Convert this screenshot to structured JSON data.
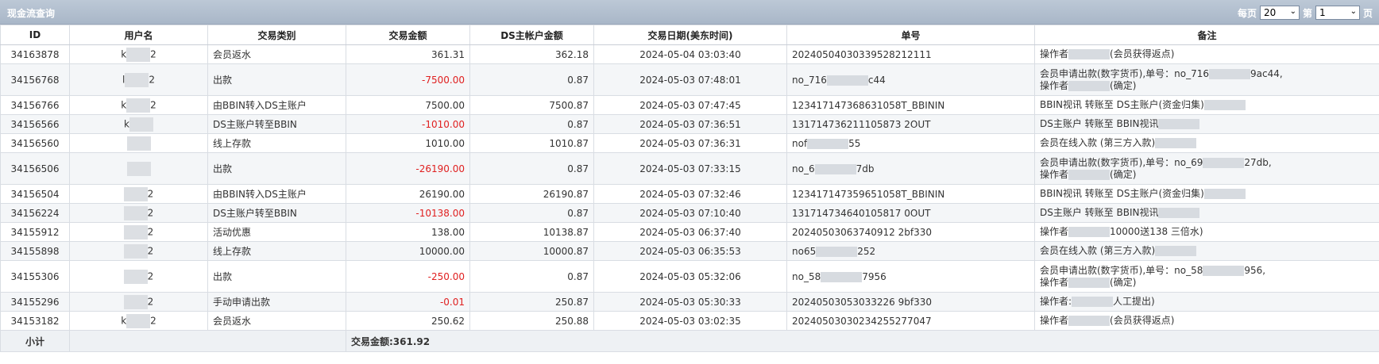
{
  "panel": {
    "title": "现金流查询",
    "per_page_label": "每页",
    "per_page_value": "20",
    "page_label": "第",
    "page_value": "1",
    "page_suffix": "页"
  },
  "table": {
    "headers": [
      "ID",
      "用户名",
      "交易类别",
      "交易金额",
      "DS主帐户金额",
      "交易日期(美东时间)",
      "单号",
      "备注"
    ],
    "rows": [
      {
        "id": "34163878",
        "user_a": "k",
        "user_b": "2",
        "type": "会员返水",
        "amount": "361.31",
        "neg": false,
        "balance": "362.18",
        "date": "2024-05-04 03:03:40",
        "order_a": "20240504030339528212111",
        "order_b": "",
        "note1_a": "操作者",
        "note1_b": "(会员获得返点)",
        "note2_a": "",
        "note2_b": ""
      },
      {
        "id": "34156768",
        "user_a": "l",
        "user_b": "2",
        "type": "出款",
        "amount": "-7500.00",
        "neg": true,
        "balance": "0.87",
        "date": "2024-05-03 07:48:01",
        "order_a": "no_716",
        "order_b": "c44",
        "note1_a": "会员申请出款(数字货币),单号：no_716",
        "note1_b": "9ac44,",
        "note2_a": "操作者",
        "note2_b": "(确定)"
      },
      {
        "id": "34156766",
        "user_a": "k",
        "user_b": "2",
        "type": "由BBIN转入DS主账户",
        "amount": "7500.00",
        "neg": false,
        "balance": "7500.87",
        "date": "2024-05-03 07:47:45",
        "order_a": "123417147368631058T_BBININ",
        "order_b": "",
        "note1_a": "BBIN视讯 转账至 DS主账户(资金归集)",
        "note1_b": "",
        "note2_a": "",
        "note2_b": ""
      },
      {
        "id": "34156566",
        "user_a": "k",
        "user_b": "",
        "type": "DS主账户转至BBIN",
        "amount": "-1010.00",
        "neg": true,
        "balance": "0.87",
        "date": "2024-05-03 07:36:51",
        "order_a": "131714736211105873 2OUT",
        "order_b": "",
        "note1_a": "DS主账户 转账至 BBIN视讯",
        "note1_b": "",
        "note2_a": "",
        "note2_b": ""
      },
      {
        "id": "34156560",
        "user_a": "",
        "user_b": "",
        "type": "线上存款",
        "amount": "1010.00",
        "neg": false,
        "balance": "1010.87",
        "date": "2024-05-03 07:36:31",
        "order_a": "nof",
        "order_b": "55",
        "note1_a": "会员在线入款 (第三方入款)",
        "note1_b": "",
        "note2_a": "",
        "note2_b": ""
      },
      {
        "id": "34156506",
        "user_a": "",
        "user_b": "",
        "type": "出款",
        "amount": "-26190.00",
        "neg": true,
        "balance": "0.87",
        "date": "2024-05-03 07:33:15",
        "order_a": "no_6",
        "order_b": "7db",
        "note1_a": "会员申请出款(数字货币),单号：no_69",
        "note1_b": "27db,",
        "note2_a": "操作者",
        "note2_b": "(确定)"
      },
      {
        "id": "34156504",
        "user_a": "",
        "user_b": "2",
        "type": "由BBIN转入DS主账户",
        "amount": "26190.00",
        "neg": false,
        "balance": "26190.87",
        "date": "2024-05-03 07:32:46",
        "order_a": "123417147359651058T_BBININ",
        "order_b": "",
        "note1_a": "BBIN视讯 转账至 DS主账户(资金归集)",
        "note1_b": "",
        "note2_a": "",
        "note2_b": ""
      },
      {
        "id": "34156224",
        "user_a": "",
        "user_b": "2",
        "type": "DS主账户转至BBIN",
        "amount": "-10138.00",
        "neg": true,
        "balance": "0.87",
        "date": "2024-05-03 07:10:40",
        "order_a": "131714734640105817 0OUT",
        "order_b": "",
        "note1_a": "DS主账户 转账至 BBIN视讯",
        "note1_b": "",
        "note2_a": "",
        "note2_b": ""
      },
      {
        "id": "34155912",
        "user_a": "",
        "user_b": "2",
        "type": "活动优惠",
        "amount": "138.00",
        "neg": false,
        "balance": "10138.87",
        "date": "2024-05-03 06:37:40",
        "order_a": "20240503063740912 2bf330",
        "order_b": "",
        "note1_a": "操作者",
        "note1_b": "10000送138 三倍水)",
        "note2_a": "",
        "note2_b": ""
      },
      {
        "id": "34155898",
        "user_a": "",
        "user_b": "2",
        "type": "线上存款",
        "amount": "10000.00",
        "neg": false,
        "balance": "10000.87",
        "date": "2024-05-03 06:35:53",
        "order_a": "no65",
        "order_b": "252",
        "note1_a": "会员在线入款 (第三方入款)",
        "note1_b": "",
        "note2_a": "",
        "note2_b": ""
      },
      {
        "id": "34155306",
        "user_a": "",
        "user_b": "2",
        "type": "出款",
        "amount": "-250.00",
        "neg": true,
        "balance": "0.87",
        "date": "2024-05-03 05:32:06",
        "order_a": "no_58",
        "order_b": "7956",
        "note1_a": "会员申请出款(数字货币),单号：no_58",
        "note1_b": "956,",
        "note2_a": "操作者",
        "note2_b": "(确定)"
      },
      {
        "id": "34155296",
        "user_a": "",
        "user_b": "2",
        "type": "手动申请出款",
        "amount": "-0.01",
        "neg": true,
        "balance": "250.87",
        "date": "2024-05-03 05:30:33",
        "order_a": "20240503053033226 9bf330",
        "order_b": "",
        "note1_a": "操作者:",
        "note1_b": "人工提出)",
        "note2_a": "",
        "note2_b": ""
      },
      {
        "id": "34153182",
        "user_a": "k",
        "user_b": "2",
        "type": "会员返水",
        "amount": "250.62",
        "neg": false,
        "balance": "250.88",
        "date": "2024-05-03 03:02:35",
        "order_a": "20240503030234255277047",
        "order_b": "",
        "note1_a": "操作者",
        "note1_b": "(会员获得返点)",
        "note2_a": "",
        "note2_b": ""
      }
    ]
  },
  "footer": {
    "subtotal_label": "小计",
    "total_text": "交易金额:361.92"
  },
  "colors": {
    "title_bar": "#b4c1d1",
    "negative": "#e02020",
    "row_alt": "#f4f6f8"
  }
}
